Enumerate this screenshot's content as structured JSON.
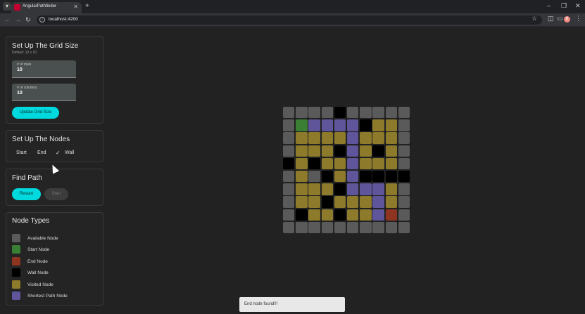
{
  "browser": {
    "tab_title": "AngularPathfinder",
    "new_tab_symbol": "+",
    "url": "localhost:4200",
    "profile_letter": "B"
  },
  "grid_size": {
    "title": "Set Up The Grid Size",
    "subtitle": "Default: 10 x 10",
    "rows_label": "# of rows",
    "rows_value": "10",
    "cols_label": "# of columns",
    "cols_value": "10",
    "update_button": "Update Grid Size"
  },
  "nodes": {
    "title": "Set Up The Nodes",
    "options": [
      "Start",
      "End",
      "Wall"
    ],
    "selected": "Wall"
  },
  "find_path": {
    "title": "Find Path",
    "restart_button": "Restart",
    "start_button": "Start"
  },
  "node_types": {
    "title": "Node Types",
    "items": [
      {
        "label": "Available Node",
        "color": "#5a5a5a"
      },
      {
        "label": "Start Node",
        "color": "#3a7f34"
      },
      {
        "label": "End Node",
        "color": "#8e3420"
      },
      {
        "label": "Wall Node",
        "color": "#000000"
      },
      {
        "label": "Visited Node",
        "color": "#8d7a2a"
      },
      {
        "label": "Shortest Path Node",
        "color": "#5f559a"
      }
    ]
  },
  "grid": {
    "colors": {
      "A": "#5a5a5a",
      "S": "#3a7f34",
      "E": "#8e3420",
      "W": "#000000",
      "V": "#8d7a2a",
      "P": "#5f559a"
    },
    "rows": [
      "AAAAWAAAAA",
      "ASPPPPWVVA",
      "AVVVVPVVVA",
      "AVVVWPVWVA",
      "WVWVVPVVVA",
      "AVAWVPWWWW",
      "AVVVWPPPVA",
      "AVVWVVVPVA",
      "AWVVWVVPEA",
      "AAAAAAAAAA"
    ]
  },
  "snackbar": {
    "message": "End node found!!!"
  }
}
